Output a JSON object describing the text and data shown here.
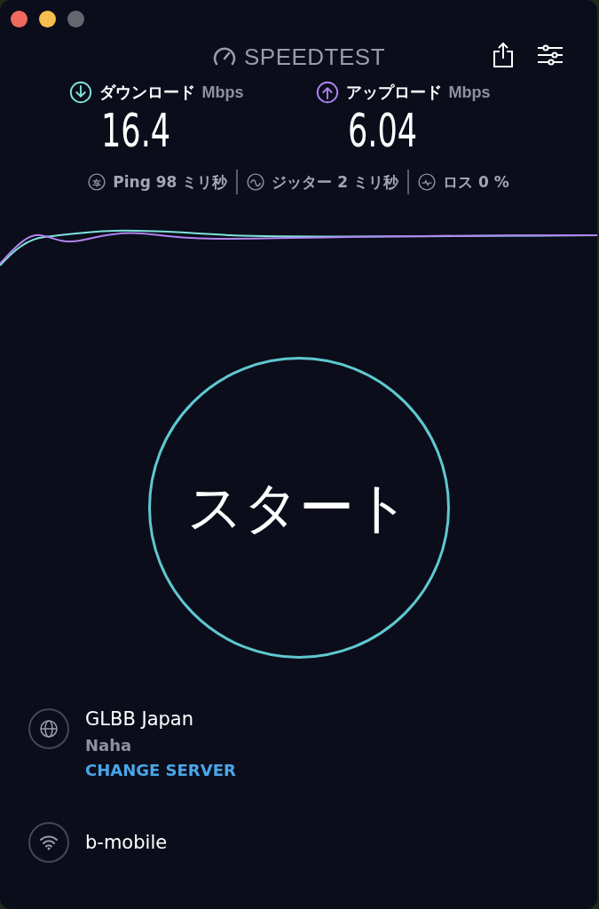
{
  "window": {
    "controls": [
      {
        "kind": "close",
        "disabled": false
      },
      {
        "kind": "minimize",
        "disabled": false
      },
      {
        "kind": "zoom",
        "disabled": true
      }
    ]
  },
  "header": {
    "logo": "SPEEDTEST"
  },
  "metrics": [
    {
      "kind": "download",
      "label": "ダウンロード",
      "unit": "Mbps",
      "value": "16.4"
    },
    {
      "kind": "upload",
      "label": "アップロード",
      "unit": "Mbps",
      "value": "6.04"
    }
  ],
  "stats": [
    {
      "kind": "ping",
      "text": "Ping 98 ミリ秒"
    },
    {
      "kind": "jitter",
      "text": "ジッター 2 ミリ秒"
    },
    {
      "kind": "loss",
      "text": "ロス 0 %"
    }
  ],
  "start_button": {
    "label": "スタート"
  },
  "server": {
    "name": "GLBB Japan",
    "location": "Naha",
    "link": "CHANGE SERVER"
  },
  "network": {
    "name": "b-mobile"
  }
}
